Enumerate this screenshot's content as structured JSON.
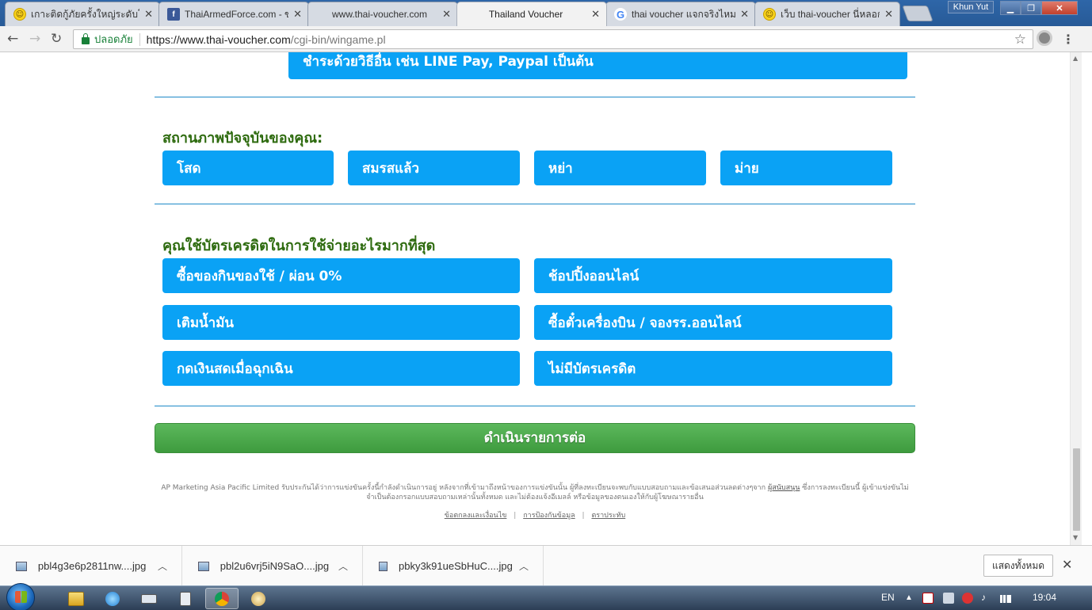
{
  "browser": {
    "tabs": [
      {
        "title": "เกาะติดกู้ภัยครั้งใหญ่ระดับโลก",
        "favicon": "smiley-icon",
        "active": false
      },
      {
        "title": "ThaiArmedForce.com - ข่",
        "favicon": "facebook-icon",
        "active": false
      },
      {
        "title": "www.thai-voucher.com",
        "favicon": "",
        "active": false
      },
      {
        "title": "Thailand Voucher",
        "favicon": "",
        "active": true
      },
      {
        "title": "thai voucher แจกจริงไหม",
        "favicon": "google-icon",
        "active": false
      },
      {
        "title": "เว็บ thai-voucher นี่หลอกอ",
        "favicon": "smiley-icon",
        "active": false
      }
    ],
    "user_name": "Khun Yut",
    "secure_label": "ปลอดภัย",
    "url_host": "https://www.thai-voucher.com",
    "url_path": "/cgi-bin/wingame.pl"
  },
  "page": {
    "payment_option": "ชำระด้วยวิธีอื่น เช่น LINE Pay, Paypal เป็นต้น",
    "status_question": "สถานภาพปัจจุบันของคุณ:",
    "status_options": [
      "โสด",
      "สมรสแล้ว",
      "หย่า",
      "ม่าย"
    ],
    "credit_question": "คุณใช้บัตรเครดิตในการใช้จ่ายอะไรมากที่สุด",
    "credit_options": [
      "ซื้อของกินของใช้ / ผ่อน 0%",
      "ช้อปปิ้งออนไลน์",
      "เติมน้ำมัน",
      "ซื้อตั๋วเครื่องบิน / จองรร.ออนไลน์",
      "กดเงินสดเมื่อฉุกเฉิน",
      "ไม่มีบัตรเครดิต"
    ],
    "continue_label": "ดำเนินรายการต่อ",
    "disclaimer_part1": "AP Marketing Asia Pacific Limited รับประกันได้ว่าการแข่งขันครั้งนี้กำลังดำเนินการอยู่ หลังจากที่เข้ามาถึงหน้าของการแข่งขันนั้น ผู้ที่ลงทะเบียนจะพบกับแบบสอบถามและข้อเสนอส่วนลดต่างๆจาก",
    "disclaimer_sponsor": "ผู้สนับสนุน",
    "disclaimer_part2": "ซึ่งการลงทะเบียนนี้ ผู้เข้าแข่งขันไม่จำเป็นต้องกรอกแบบสอบถามเหล่านั้นทั้งหมด และไม่ต้องแจ้งอีเมลล์ หรือข้อมูลของตนเองให้กับผู้โฆษณารายอื่น",
    "footer_links": [
      "ข้อตกลงและเงื่อนไข",
      "การป้องกันข้อมูล",
      "ตราประทับ"
    ]
  },
  "downloads": {
    "files": [
      "pbl4g3e6p2811nw....jpg",
      "pbl2u6vrj5iN9SaO....jpg",
      "pbky3k91ueSbHuC....jpg"
    ],
    "show_all_label": "แสดงทั้งหมด"
  },
  "taskbar": {
    "language": "EN",
    "time": "19:04"
  },
  "colors": {
    "option_blue": "#0aa2f5",
    "label_green": "#2e6b0f",
    "cta_green": "#4cae4c",
    "divider_blue": "#1d89c8"
  }
}
